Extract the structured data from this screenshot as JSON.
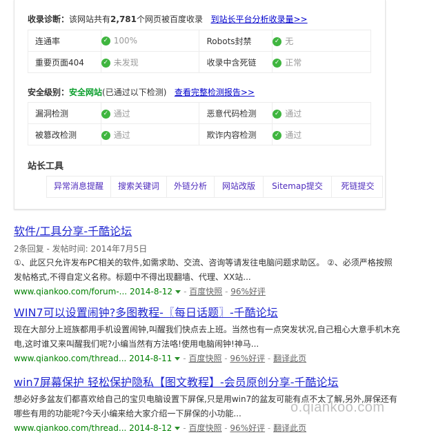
{
  "diagnosis": {
    "head_label": "收录诊断：",
    "head_text_pre": "该网站共有",
    "head_count": "2,781",
    "head_text_post": "个网页被百度收录",
    "head_link": "到站长平台分析收录量>>",
    "rows": [
      {
        "l1": "连通率",
        "v1": "100%",
        "l2": "Robots封禁",
        "v2": "无"
      },
      {
        "l1": "重要页面404",
        "v1": "未发现",
        "l2": "收录中含死链",
        "v2": "正常"
      }
    ]
  },
  "security": {
    "head_label": "安全级别：",
    "level": "安全网站",
    "note": "(已通过以下检测)",
    "link": "查看完整检测报告>>",
    "rows": [
      {
        "l1": "漏洞检测",
        "v1": "通过",
        "l2": "恶意代码检测",
        "v2": "通过"
      },
      {
        "l1": "被篡改检测",
        "v1": "通过",
        "l2": "欺诈内容检测",
        "v2": "通过"
      }
    ]
  },
  "tools": {
    "title": "站长工具",
    "items": [
      "异常消息提醒",
      "搜索关键词",
      "外链分析",
      "网站改版",
      "Sitemap提交",
      "死链提交"
    ]
  },
  "results": [
    {
      "title": "软件/工具分享-千酷论坛",
      "meta": "2条回复 - 发帖时间: 2014年7月5日",
      "abstract": "①、此区只允许发布PC相关的软件,如需求助、交流、咨询等请发往电脑问题求助区。 ②、必须严格按照发帖格式,不得自定义名称。标题中不得出现翻墙、代理、XX站...",
      "url": "www.qiankoo.com/forum-...",
      "date": "2014-8-12",
      "actions": [
        "百度快照",
        "96%好评"
      ]
    },
    {
      "title": "WIN7可以设置闹钟?多图教程-〖每日话题〗-千酷论坛",
      "meta": "",
      "abstract": "现在大部分上班族都用手机设置闹钟,叫醒我们快点去上班。当然也有一点突发状况,自己粗心大意手机木充电,这时谁又来叫醒我们呢?小编当然有方法咯!使用电脑闹钟!神马...",
      "url": "www.qiankoo.com/thread...",
      "date": "2014-8-11",
      "actions": [
        "百度快照",
        "96%好评",
        "翻译此页"
      ]
    },
    {
      "title": "win7屏幕保护 轻松保护隐私【图文教程】-会员原创分享-千酷论坛",
      "meta": "",
      "abstract": "想必好多盆友们都喜欢给自己的宝贝电脑设置下屏保,只是用win7的盆友可能有点不太了解,另外,屏保还有哪些有用的功能呢?今天小编来给大家介绍一下屏保的小功能...",
      "url": "www.qiankoo.com/thread...",
      "date": "2014-8-12",
      "actions": [
        "百度快照",
        "96%好评",
        "翻译此页"
      ]
    }
  ],
  "watermark": "o.qiankoo.com",
  "check_icon": "check-circle-icon"
}
